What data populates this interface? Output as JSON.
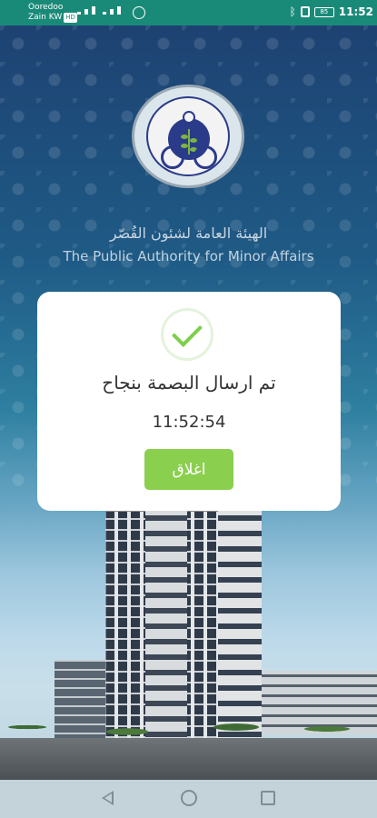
{
  "status_bar": {
    "carrier_line1": "Ooredoo",
    "carrier_line2": "Zain KW",
    "hd_badge": "HD",
    "battery": "85",
    "time": "11:52"
  },
  "header": {
    "org_name_ar": "الهيئة العامة لشئون القُصّر",
    "org_name_en": "The Public Authority for Minor Affairs"
  },
  "dialog": {
    "message": "تم ارسال البصمة بنجاح",
    "time": "11:52:54",
    "close_label": "اغلاق",
    "accent_color": "#8bcf4f"
  },
  "icons": {
    "status": [
      "signal-icon",
      "whatsapp-icon",
      "bluetooth-icon",
      "vibrate-icon",
      "battery-icon"
    ],
    "dialog": "check-icon",
    "nav": [
      "back-icon",
      "home-icon",
      "recent-apps-icon"
    ]
  }
}
